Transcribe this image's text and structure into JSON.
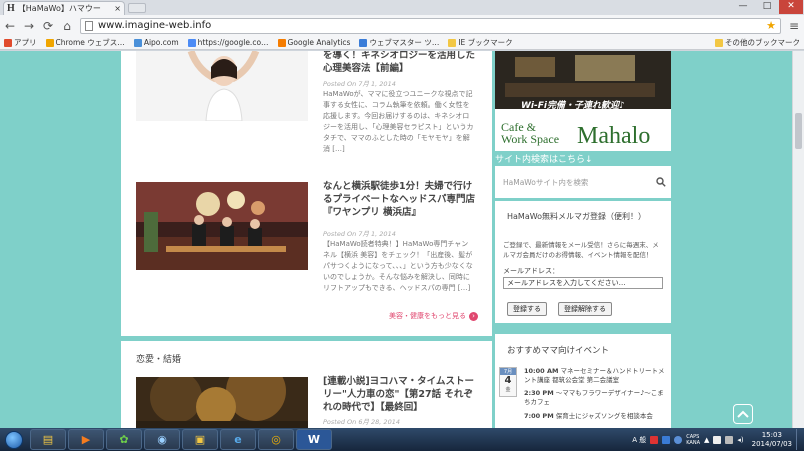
{
  "browser": {
    "tab_title": "【HaMaWo】ハマウー",
    "tab_favicon": "H",
    "tab_close": "×",
    "url": "www.imagine-web.info",
    "window_controls": [
      "—",
      "□",
      "✕"
    ]
  },
  "bookmarks": {
    "items": [
      {
        "label": "アプリ",
        "icon_color": "#e04b2d",
        "icon": "apps-icon"
      },
      {
        "label": "Chrome ウェブス…",
        "icon_color": "#f0a500",
        "icon": "chrome-store-icon"
      },
      {
        "label": "Aipo.com",
        "icon_color": "#4a90d9",
        "icon": "aipo-icon"
      },
      {
        "label": "https://google.co…",
        "icon_color": "#4c8bf5",
        "icon": "google-icon"
      },
      {
        "label": "Google Analytics",
        "icon_color": "#f57c00",
        "icon": "analytics-icon"
      },
      {
        "label": "ウェブマスター ツ…",
        "icon_color": "#3b7dd8",
        "icon": "webmaster-icon"
      },
      {
        "label": "IE ブックマーク",
        "icon_color": "#f2c744",
        "icon": "folder-icon"
      }
    ],
    "other": {
      "label": "その他のブックマーク",
      "icon_color": "#f2c744"
    }
  },
  "articles": [
    {
      "title": "を導く！キネシオロジーを活用した心理美容法【前編】",
      "date": "Posted On 7月 1, 2014",
      "excerpt": "HaMaWoが、ママに役立つユニークな視点で記事する女性に、コラム執筆を依頼。働く女性を応援します。今回お届けするのは、キネシオロジーを活用し、「心理美容セラピスト」というカタチで、ママのふとした時の「モヤモヤ」を解消 […]"
    },
    {
      "title": "なんと横浜駅徒歩1分！夫婦で行けるプライベートなヘッドスパ専門店『ワヤンプリ 横浜店』",
      "date": "Posted On 7月 1, 2014",
      "excerpt": "【HaMaWo読者特典！】HaMaWo専門チャンネル【横浜 美容】をチェック！「出産後、髪がパサつくようになって、、、」という方も少なくないのでしょうか。そんな悩みを解決し、同時にリフトアップもできる、ヘッドスパの専門 […]"
    }
  ],
  "more_link": "美容・健康をもっと見る",
  "section2": {
    "title": "恋愛・結婚",
    "article": {
      "title": "[連載小説]ヨコハマ・タイムストーリー\"人力車の恋\"【第27話 それぞれの時代で】【最終回】",
      "date": "Posted On 6月 28, 2014"
    }
  },
  "sidebar": {
    "banner_line1": "Wi-Fi完備・子連れ歓迎♪",
    "banner_cafe": "Cafe &\nWork Space",
    "banner_name": "Mahalo",
    "search_heading": "サイト内検索はこちら↓",
    "search_placeholder": "HaMaWoサイト内を検索",
    "newsletter": {
      "title": "HaMaWo無料メルマガ登録（便利！）",
      "description": "ご登録で、最新情報をメール受信！さらに毎週末、メルマガ会員だけのお得情報、イベント情報を配信！",
      "email_label": "メールアドレス：",
      "email_value": "メールアドレスを入力してください…",
      "subscribe": "登録する",
      "unsubscribe": "登録解除する"
    },
    "events": {
      "title": "おすすめママ向けイベント",
      "date_month": "7月",
      "date_day": "4",
      "date_dow": "金",
      "items": [
        {
          "time": "10:00 AM",
          "text": "マネーセミナー＆ハンドトリートメント講座 都筑公会堂 第二会議室"
        },
        {
          "time": "2:30 PM",
          "text": "〜ママもフラワーデザイナー♪〜こまちカフェ"
        },
        {
          "time": "7:00 PM",
          "text": "保育士にジャズソングを相談本会"
        }
      ]
    }
  },
  "taskbar": {
    "apps": [
      "explorer-icon",
      "media-player-icon",
      "gadget-icon",
      "network-icon",
      "folder-icon",
      "ie-icon",
      "chrome-icon",
      "word-icon"
    ],
    "time": "15:03",
    "date": "2014/07/03",
    "ime_label": "A 般",
    "caps": "CAPS\nKANA"
  }
}
